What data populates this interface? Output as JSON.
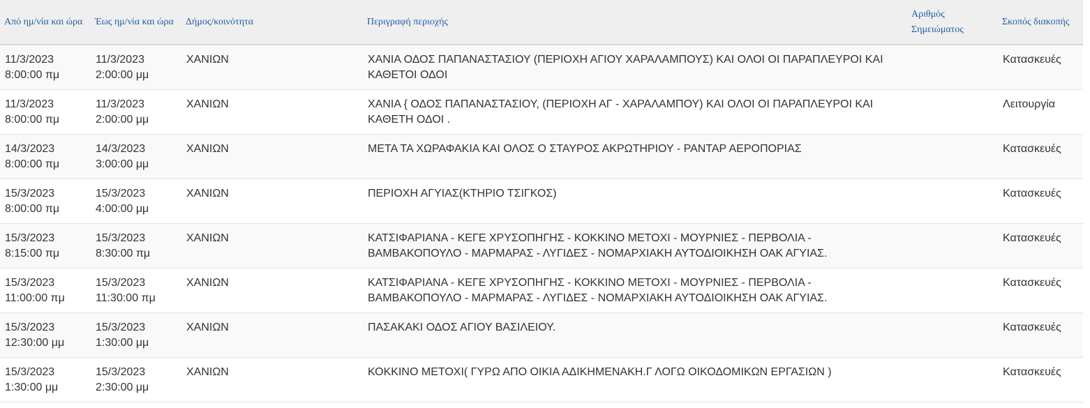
{
  "table": {
    "headers": {
      "from": "Από ημ/νία και ώρα",
      "to": "Έως ημ/νία και ώρα",
      "municipality": "Δήμος/κοινότητα",
      "description": "Περιγραφή περιοχής",
      "note_number": "Αριθμός Σημειώματος",
      "purpose": "Σκοπός διακοπής"
    },
    "rows": [
      {
        "from_date": "11/3/2023",
        "from_time": "8:00:00 πμ",
        "to_date": "11/3/2023",
        "to_time": "2:00:00 μμ",
        "municipality": "ΧΑΝΙΩΝ",
        "description": "ΧΑΝΙΑ ΟΔΟΣ ΠΑΠΑΝΑΣΤΑΣΙΟΥ (ΠΕΡΙΟΧΗ ΑΓΙΟΥ ΧΑΡΑΛΑΜΠΟΥΣ) ΚΑΙ ΟΛΟΙ ΟΙ ΠΑΡΑΠΛΕΥΡΟΙ ΚΑΙ ΚΑΘΕΤΟΙ ΟΔΟΙ",
        "note_number": "",
        "purpose": "Κατασκευές"
      },
      {
        "from_date": "11/3/2023",
        "from_time": "8:00:00 πμ",
        "to_date": "11/3/2023",
        "to_time": "2:00:00 μμ",
        "municipality": "ΧΑΝΙΩΝ",
        "description": "ΧΑΝΙΑ { ΟΔΟΣ ΠΑΠΑΝΑΣΤΑΣΙΟΥ, (ΠΕΡΙΟΧΗ ΑΓ - ΧΑΡΑΛΑΜΠΟΥ) ΚΑΙ ΟΛΟΙ ΟΙ ΠΑΡΑΠΛΕΥΡΟΙ ΚΑΙ ΚΑΘΕΤΗ ΟΔΟΙ .",
        "note_number": "",
        "purpose": "Λειτουργία"
      },
      {
        "from_date": "14/3/2023",
        "from_time": "8:00:00 πμ",
        "to_date": "14/3/2023",
        "to_time": "3:00:00 μμ",
        "municipality": "ΧΑΝΙΩΝ",
        "description": "ΜΕΤΑ ΤΑ ΧΩΡΑΦΑΚΙΑ ΚΑΙ ΟΛΟΣ Ο ΣΤΑΥΡΟΣ ΑΚΡΩΤΗΡΙΟΥ - ΡΑΝΤΑΡ ΑΕΡΟΠΟΡΙΑΣ",
        "note_number": "",
        "purpose": "Κατασκευές"
      },
      {
        "from_date": "15/3/2023",
        "from_time": "8:00:00 πμ",
        "to_date": "15/3/2023",
        "to_time": "4:00:00 μμ",
        "municipality": "ΧΑΝΙΩΝ",
        "description": "ΠΕΡΙΟΧΗ ΑΓΥΙΑΣ(ΚΤΗΡΙΟ ΤΣΙΓΚΟΣ)",
        "note_number": "",
        "purpose": "Κατασκευές"
      },
      {
        "from_date": "15/3/2023",
        "from_time": "8:15:00 πμ",
        "to_date": "15/3/2023",
        "to_time": "8:30:00 πμ",
        "municipality": "ΧΑΝΙΩΝ",
        "description": "ΚΑΤΣΙΦΑΡΙΑΝΑ - ΚΕΓΕ ΧΡΥΣΟΠΗΓΗΣ - ΚΟΚΚΙΝΟ ΜΕΤΟΧΙ - ΜΟΥΡΝΙΕΣ - ΠΕΡΒΟΛΙΑ - ΒΑΜΒΑΚΟΠΟΥΛΟ - ΜΑΡΜΑΡΑΣ - ΛΥΓΙΔΕΣ - ΝΟΜΑΡΧΙΑΚΗ ΑΥΤΟΔΙΟΙΚΗΣΗ ΟΑΚ ΑΓΥΙΑΣ.",
        "note_number": "",
        "purpose": "Κατασκευές"
      },
      {
        "from_date": "15/3/2023",
        "from_time": "11:00:00 πμ",
        "to_date": "15/3/2023",
        "to_time": "11:30:00 πμ",
        "municipality": "ΧΑΝΙΩΝ",
        "description": "ΚΑΤΣΙΦΑΡΙΑΝΑ - ΚΕΓΕ ΧΡΥΣΟΠΗΓΗΣ - ΚΟΚΚΙΝΟ ΜΕΤΟΧΙ - ΜΟΥΡΝΙΕΣ - ΠΕΡΒΟΛΙΑ - ΒΑΜΒΑΚΟΠΟΥΛΟ - ΜΑΡΜΑΡΑΣ - ΛΥΓΙΔΕΣ - ΝΟΜΑΡΧΙΑΚΗ ΑΥΤΟΔΙΟΙΚΗΣΗ ΟΑΚ ΑΓΥΙΑΣ.",
        "note_number": "",
        "purpose": "Κατασκευές"
      },
      {
        "from_date": "15/3/2023",
        "from_time": "12:30:00 μμ",
        "to_date": "15/3/2023",
        "to_time": "1:30:00 μμ",
        "municipality": "ΧΑΝΙΩΝ",
        "description": "ΠΑΣΑΚΑΚΙ ΟΔΟΣ ΑΓΙΟΥ ΒΑΣΙΛΕΙΟΥ.",
        "note_number": "",
        "purpose": "Κατασκευές"
      },
      {
        "from_date": "15/3/2023",
        "from_time": "1:30:00 μμ",
        "to_date": "15/3/2023",
        "to_time": "2:30:00 μμ",
        "municipality": "ΧΑΝΙΩΝ",
        "description": "ΚΟΚΚΙΝΟ ΜΕΤΟΧΙ( ΓΥΡΩ ΑΠΟ ΟΙΚΙΑ ΑΔΙΚΗΜΕΝΑΚΗ.Γ ΛΟΓΩ ΟΙΚΟΔΟΜΙΚΩΝ ΕΡΓΑΣΙΩΝ )",
        "note_number": "",
        "purpose": "Κατασκευές"
      }
    ]
  }
}
